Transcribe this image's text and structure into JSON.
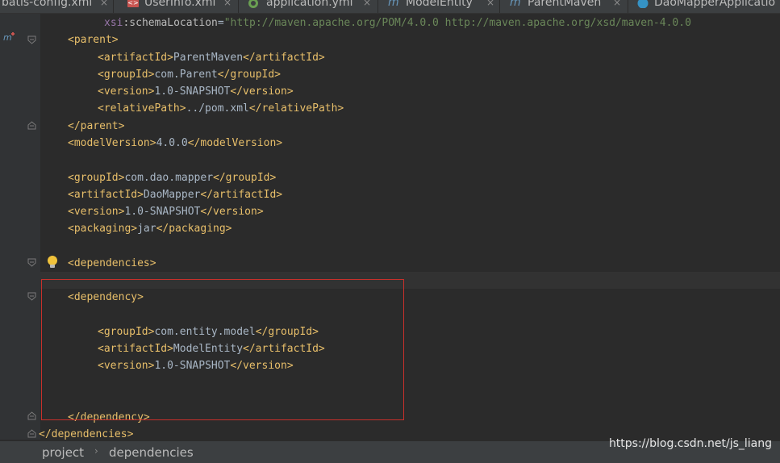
{
  "tabs": [
    {
      "label": "batis-config.xml",
      "icon": "xml-file-icon"
    },
    {
      "label": "UserInfo.xml",
      "icon": "xml-file-icon"
    },
    {
      "label": "application.yml",
      "icon": "spring-leaf-icon"
    },
    {
      "label": "ModelEntity",
      "icon": "maven-m-icon"
    },
    {
      "label": "ParentMaven",
      "icon": "maven-m-icon"
    },
    {
      "label": "DaoMapperApplicatio",
      "icon": "class-c-icon"
    }
  ],
  "tab_close_glyph": "×",
  "code": {
    "schema_attr": "xsi",
    "schema_attr2": ":schemaLocation",
    "schema_eq": "=",
    "schema_val": "\"http://maven.apache.org/POM/4.0.0 http://maven.apache.org/xsd/maven-4.0.0",
    "parent_open": "<parent>",
    "p_artifact_open": "<artifactId>",
    "p_artifact_val": "ParentMaven",
    "p_artifact_close": "</artifactId>",
    "p_group_open": "<groupId>",
    "p_group_val": "com.Parent",
    "p_group_close": "</groupId>",
    "p_version_open": "<version>",
    "p_version_val": "1.0-SNAPSHOT",
    "p_version_close": "</version>",
    "p_rel_open": "<relativePath>",
    "p_rel_val": "../pom.xml",
    "p_rel_close": "</relativePath>",
    "parent_close": "</parent>",
    "mv_open": "<modelVersion>",
    "mv_val": "4.0.0",
    "mv_close": "</modelVersion>",
    "g_open": "<groupId>",
    "g_val": "com.dao.mapper",
    "g_close": "</groupId>",
    "a_open": "<artifactId>",
    "a_val": "DaoMapper",
    "a_close": "</artifactId>",
    "v_open": "<version>",
    "v_val": "1.0-SNAPSHOT",
    "v_close": "</version>",
    "pk_open": "<packaging>",
    "pk_val": "jar",
    "pk_close": "</packaging>",
    "deps_open": "<dependencies>",
    "dep_open": "<dependency>",
    "d_group_open": "<groupId>",
    "d_group_val": "com.entity.model",
    "d_group_close": "</groupId>",
    "d_artifact_open": "<artifactId>",
    "d_artifact_val": "ModelEntity",
    "d_artifact_close": "</artifactId>",
    "d_version_open": "<version>",
    "d_version_val": "1.0-SNAPSHOT",
    "d_version_close": "</version>",
    "dep_close": "</dependency>",
    "deps_close": "</dependencies>"
  },
  "breadcrumb": {
    "items": [
      "project",
      "dependencies"
    ],
    "separator": "›"
  },
  "watermark": "https://blog.csdn.net/js_liang",
  "colors": {
    "editor_bg": "#2b2b2b",
    "tag": "#e8bf6a",
    "text": "#a9b7c6",
    "string": "#6a8759",
    "annotation_box": "#c7302b"
  }
}
